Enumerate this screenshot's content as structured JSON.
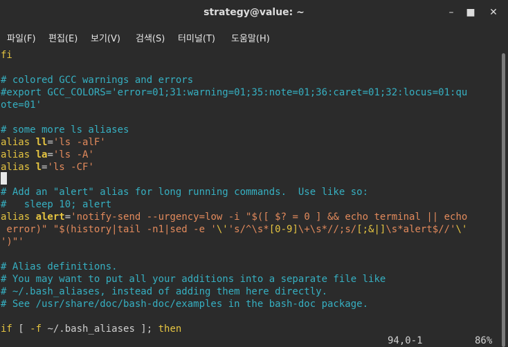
{
  "window": {
    "title": "strategy@value: ~"
  },
  "menu": {
    "file": "파일(F)",
    "edit": "편집(E)",
    "view": "보기(V)",
    "search": "검색(S)",
    "terminal": "터미널(T)",
    "help": "도움말(H)"
  },
  "colors": {
    "background": "#2b2b2b",
    "comment": "#36b0c2",
    "keyword": "#e5c441",
    "string": "#e28a5c",
    "text": "#d0d0d0"
  },
  "lines": [
    [
      {
        "t": "fi",
        "c": "#e5c441"
      }
    ],
    [],
    [
      {
        "t": "# colored GCC warnings and errors",
        "c": "#36b0c2"
      }
    ],
    [
      {
        "t": "#export GCC_COLORS='error=01;31:warning=01;35:note=01;36:caret=01;32:locus=01:qu",
        "c": "#36b0c2"
      }
    ],
    [
      {
        "t": "ote=01'",
        "c": "#36b0c2"
      }
    ],
    [],
    [
      {
        "t": "# some more ls aliases",
        "c": "#36b0c2"
      }
    ],
    [
      {
        "t": "alias ",
        "c": "#e5c441"
      },
      {
        "t": "ll",
        "c": "#e5c441",
        "b": true
      },
      {
        "t": "=",
        "c": "#d0d0d0"
      },
      {
        "t": "'ls -alF'",
        "c": "#e28a5c"
      }
    ],
    [
      {
        "t": "alias ",
        "c": "#e5c441"
      },
      {
        "t": "la",
        "c": "#e5c441",
        "b": true
      },
      {
        "t": "=",
        "c": "#d0d0d0"
      },
      {
        "t": "'ls -A'",
        "c": "#e28a5c"
      }
    ],
    [
      {
        "t": "alias ",
        "c": "#e5c441"
      },
      {
        "t": "l",
        "c": "#e5c441",
        "b": true
      },
      {
        "t": "=",
        "c": "#d0d0d0"
      },
      {
        "t": "'ls -CF'",
        "c": "#e28a5c"
      }
    ],
    [],
    [
      {
        "t": "# Add an \"alert\" alias for long running commands.  Use like so:",
        "c": "#36b0c2"
      }
    ],
    [
      {
        "t": "#   sleep 10; alert",
        "c": "#36b0c2"
      }
    ],
    [
      {
        "t": "alias ",
        "c": "#e5c441"
      },
      {
        "t": "alert",
        "c": "#e5c441",
        "b": true
      },
      {
        "t": "=",
        "c": "#d0d0d0"
      },
      {
        "t": "'notify-send --urgency=low -i \"$([ $? = 0 ] && echo terminal || echo",
        "c": "#e28a5c"
      }
    ],
    [
      {
        "t": " error)\" \"$(history|tail -n1|sed -e '",
        "c": "#e28a5c"
      },
      {
        "t": "\\'",
        "c": "#e5c441"
      },
      {
        "t": "'s/^\\s*",
        "c": "#e28a5c"
      },
      {
        "t": "[0-9]",
        "c": "#e5c441"
      },
      {
        "t": "\\+\\s*//;s/",
        "c": "#e28a5c"
      },
      {
        "t": "[;&|]",
        "c": "#e5c441"
      },
      {
        "t": "\\s*alert$//'",
        "c": "#e28a5c"
      },
      {
        "t": "\\'",
        "c": "#e5c441"
      }
    ],
    [
      {
        "t": "')\"'",
        "c": "#e28a5c"
      }
    ],
    [],
    [
      {
        "t": "# Alias definitions.",
        "c": "#36b0c2"
      }
    ],
    [
      {
        "t": "# You may want to put all your additions into a separate file like",
        "c": "#36b0c2"
      }
    ],
    [
      {
        "t": "# ~/.bash_aliases, instead of adding them here directly.",
        "c": "#36b0c2"
      }
    ],
    [
      {
        "t": "# See /usr/share/doc/bash-doc/examples in the bash-doc package.",
        "c": "#36b0c2"
      }
    ],
    [],
    [
      {
        "t": "if",
        "c": "#e5c441"
      },
      {
        "t": " [ ",
        "c": "#d0d0d0"
      },
      {
        "t": "-f",
        "c": "#e5c441"
      },
      {
        "t": " ~/.bash_aliases ]; ",
        "c": "#d0d0d0"
      },
      {
        "t": "then",
        "c": "#e5c441"
      }
    ]
  ],
  "status": {
    "position": "94,0-1",
    "percent": "86%"
  }
}
